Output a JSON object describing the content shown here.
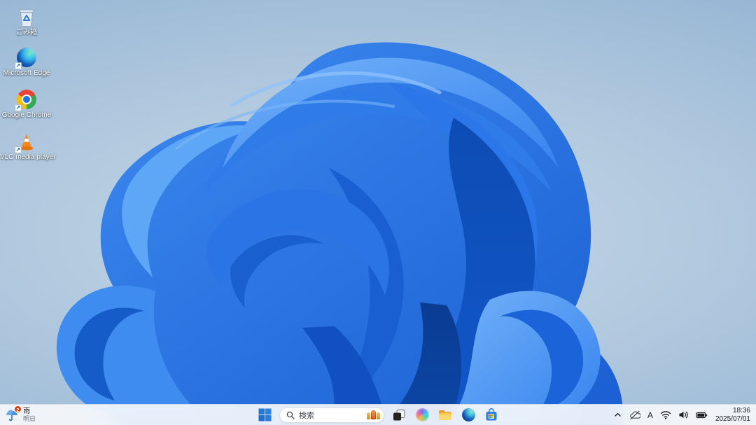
{
  "desktop": {
    "icons": [
      {
        "name": "recycle-bin",
        "label": "ごみ箱"
      },
      {
        "name": "microsoft-edge",
        "label": "Microsoft Edge"
      },
      {
        "name": "google-chrome",
        "label": "Google Chrome"
      },
      {
        "name": "vlc-media-player",
        "label": "VLC media player"
      }
    ]
  },
  "icons": {
    "shortcut_arrow": "↗"
  },
  "taskbar": {
    "weather": {
      "badge": "2",
      "condition": "雨",
      "forecast_label": "明日"
    },
    "search": {
      "placeholder": "検索"
    },
    "apps": [
      {
        "name": "start"
      },
      {
        "name": "task-view"
      },
      {
        "name": "copilot"
      },
      {
        "name": "file-explorer"
      },
      {
        "name": "microsoft-edge"
      },
      {
        "name": "microsoft-store"
      }
    ],
    "tray": {
      "icons": [
        "hidden-icons-chevron",
        "onedrive-paused",
        "ime",
        "wifi",
        "volume",
        "battery"
      ],
      "ime_mode": "A",
      "time": "18:36",
      "date": "2025/07/01"
    }
  },
  "colors": {
    "bloom_accent": "#1f6bdd",
    "background_top": "#86aacd",
    "background_center": "#c6d6e6",
    "taskbar": "#f6f9fc",
    "badge_red": "#d83b01"
  }
}
